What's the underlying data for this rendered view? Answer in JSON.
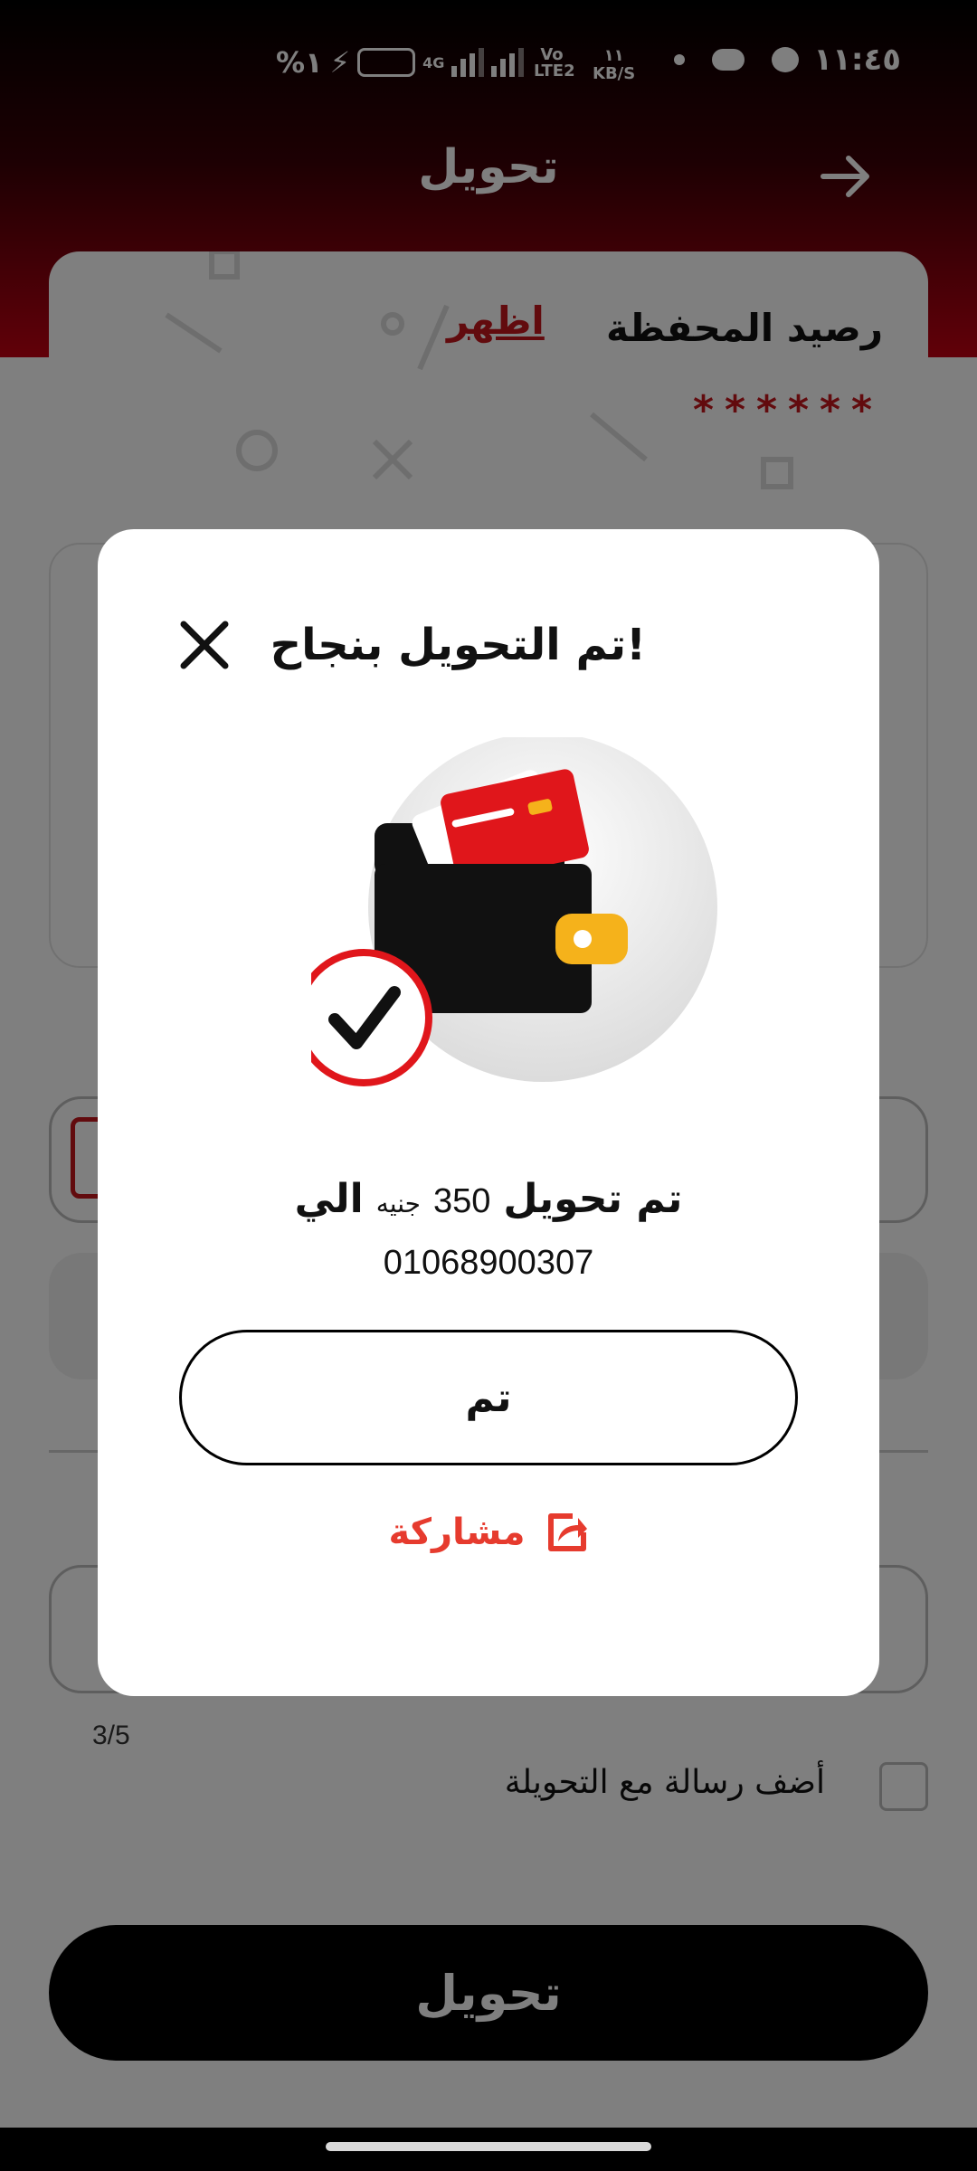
{
  "status_bar": {
    "time": "١١:٤٥",
    "battery": "%١",
    "network": "4G",
    "volte": "Vo LTE2",
    "speed_value": "١١",
    "speed_unit": "KB/S"
  },
  "screen": {
    "title": "تحويل",
    "back_icon": "arrow-right-icon"
  },
  "balance_card": {
    "label": "رصيد المحفظة",
    "show_link": "اظهر",
    "masked_value": "******"
  },
  "form": {
    "counter": "3/5",
    "add_message_label": "أضف رسالة مع التحويلة",
    "submit_label": "تحويل"
  },
  "modal": {
    "title": "تم التحويل بنجاح!",
    "result_prefix": "تم تحويل",
    "amount": "350",
    "currency": "جنيه",
    "to_word": "الي",
    "recipient": "01068900307",
    "done_label": "تم",
    "share_label": "مشاركة",
    "colors": {
      "accent": "#c4161c",
      "share": "#e63b2e",
      "wallet_badge": "#f5b21b"
    }
  }
}
